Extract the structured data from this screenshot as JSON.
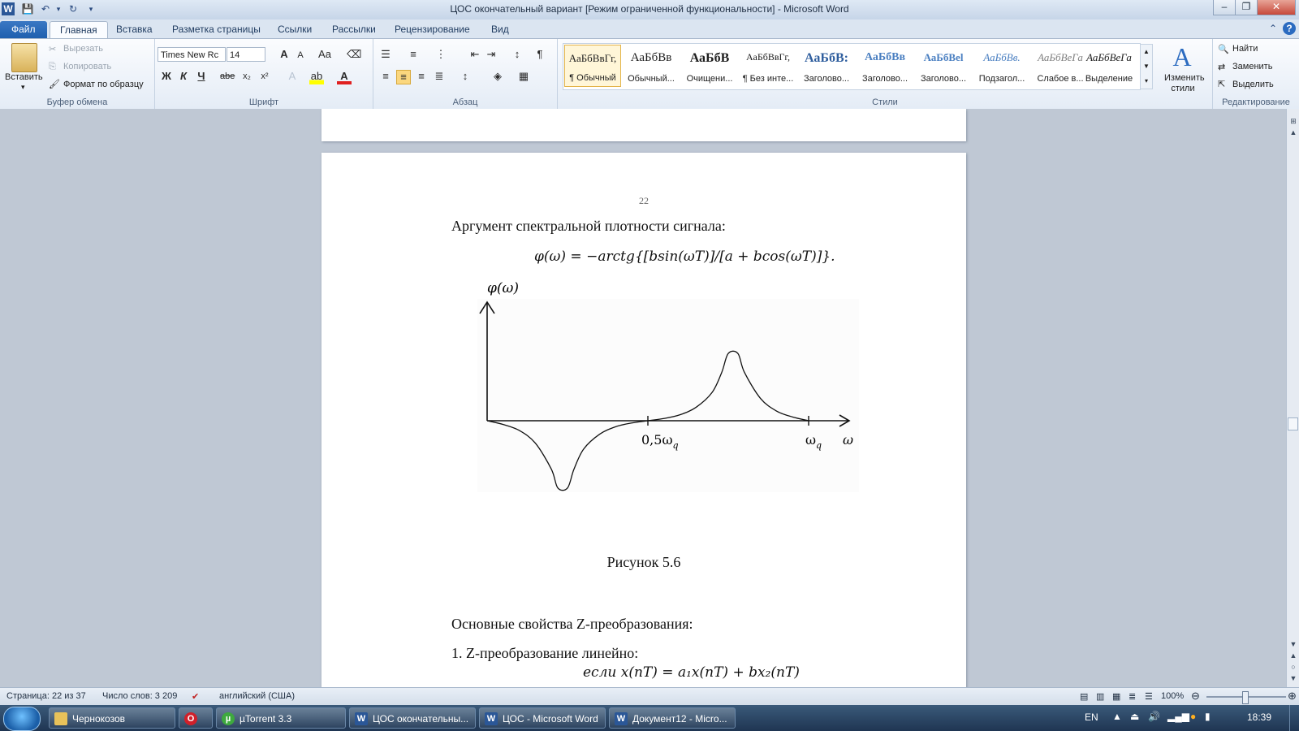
{
  "window": {
    "title": "ЦОС окончательный вариант [Режим ограниченной функциональности]  -  Microsoft Word",
    "minimize": "–",
    "restore": "❐",
    "close": "✕"
  },
  "tabs": [
    "Файл",
    "Главная",
    "Вставка",
    "Разметка страницы",
    "Ссылки",
    "Рассылки",
    "Рецензирование",
    "Вид"
  ],
  "ribbon": {
    "clipboard": {
      "label": "Буфер обмена",
      "paste": "Вставить",
      "cut": "Вырезать",
      "copy": "Копировать",
      "format_painter": "Формат по образцу"
    },
    "font": {
      "label": "Шрифт",
      "family": "Times New Rc",
      "size": "14",
      "bold": "Ж",
      "italic": "К",
      "underline": "Ч",
      "strike": "abe",
      "sub": "x₂",
      "sup": "x²",
      "case": "Aa",
      "grow": "A",
      "shrink": "A"
    },
    "paragraph": {
      "label": "Абзац",
      "pilcrow": "¶"
    },
    "styles": {
      "label": "Стили",
      "items": [
        {
          "sample": "АаБбВвГг,",
          "name": "¶ Обычный"
        },
        {
          "sample": "АаБбВв",
          "name": "Обычный..."
        },
        {
          "sample": "АаБбВ",
          "name": "Очищени..."
        },
        {
          "sample": "АаБбВвГг,",
          "name": "¶ Без инте..."
        },
        {
          "sample": "АаБбВ:",
          "name": "Заголово..."
        },
        {
          "sample": "АаБбВв",
          "name": "Заголово..."
        },
        {
          "sample": "АаБбВеl",
          "name": "Заголово..."
        },
        {
          "sample": "АаБбВв.",
          "name": "Подзагол..."
        },
        {
          "sample": "АаБбВеГа",
          "name": "Слабое в..."
        },
        {
          "sample": "АаБбВеГа",
          "name": "Выделение"
        }
      ],
      "change_styles": "Изменить стили"
    },
    "editing": {
      "label": "Редактирование",
      "find": "Найти",
      "replace": "Заменить",
      "select": "Выделить"
    }
  },
  "document": {
    "page_number": "22",
    "intro": "Аргумент спектральной плотности сигнала:",
    "formula": "φ(ω) = −arctg{[bsin(ωT)]/[a + bcos(ωT)]}.",
    "caption": "Рисунок 5.6",
    "section": "Основные свойства Z-преобразования:",
    "item1": "1.  Z-преобразование линейно:",
    "cutoff": "если x(nT) = a₁x(nT) + bx₂(nT)"
  },
  "chart_data": {
    "type": "line",
    "title": "",
    "ylabel": "φ(ω)",
    "xlabel": "ω",
    "xticks": [
      {
        "value": 0.5,
        "label": "0,5ω",
        "sub": "q"
      },
      {
        "value": 1.0,
        "label": "ω",
        "sub": "q"
      }
    ],
    "xlim": [
      0,
      1.25
    ],
    "ylim": [
      -1,
      1
    ],
    "series": [
      {
        "x": [
          0,
          0.05,
          0.1,
          0.15,
          0.2,
          0.22,
          0.25,
          0.27,
          0.3,
          0.35,
          0.4,
          0.45,
          0.5,
          0.55,
          0.6,
          0.65,
          0.7,
          0.73,
          0.75,
          0.78,
          0.8,
          0.85,
          0.9,
          0.95,
          1.0
        ],
        "y": [
          0,
          -0.05,
          -0.13,
          -0.3,
          -0.65,
          -0.9,
          -0.9,
          -0.65,
          -0.38,
          -0.18,
          -0.08,
          -0.03,
          0,
          0.03,
          0.08,
          0.18,
          0.38,
          0.65,
          0.9,
          0.9,
          0.65,
          0.3,
          0.13,
          0.05,
          0
        ]
      }
    ],
    "grid": false
  },
  "statusbar": {
    "page": "Страница: 22 из 37",
    "words": "Число слов: 3 209",
    "language": "английский (США)",
    "zoom": "100%"
  },
  "taskbar": {
    "items": [
      {
        "label": "Чернокозов",
        "icon": "folder-icon"
      },
      {
        "label": "",
        "icon": "opera-icon"
      },
      {
        "label": "µTorrent 3.3",
        "icon": "utorrent-icon"
      },
      {
        "label": "ЦОС окончательны...",
        "icon": "word-icon"
      },
      {
        "label": "ЦОС - Microsoft Word",
        "icon": "word-icon"
      },
      {
        "label": "Документ12 - Micro...",
        "icon": "word-icon"
      }
    ],
    "lang": "EN",
    "clock": "18:39"
  }
}
